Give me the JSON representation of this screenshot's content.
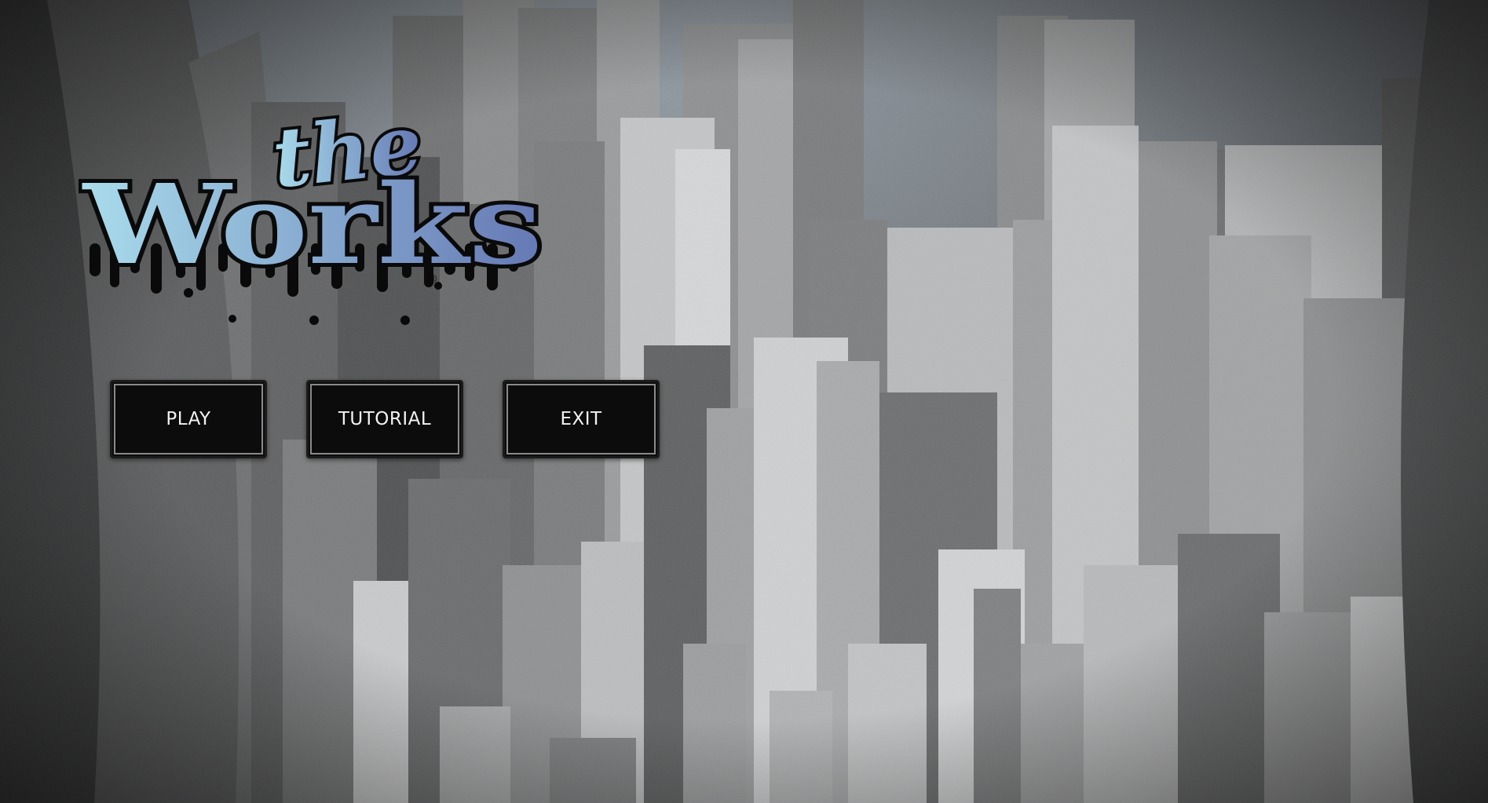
{
  "game": {
    "title": "the Works",
    "title_small": "the",
    "title_large": "Works",
    "logo_mark": "®"
  },
  "menu": {
    "play_label": "PLAY",
    "tutorial_label": "TUTORIAL",
    "exit_label": "EXIT"
  },
  "colors": {
    "logo_gradient_start": "#a9dcec",
    "logo_gradient_end": "#6578b4",
    "drip": "#0a0a0a",
    "button_bg": "#0c0c0c",
    "button_text": "#f2f2f2",
    "button_inner_border": "#8a8a8a",
    "sky": "#7f8a93"
  }
}
